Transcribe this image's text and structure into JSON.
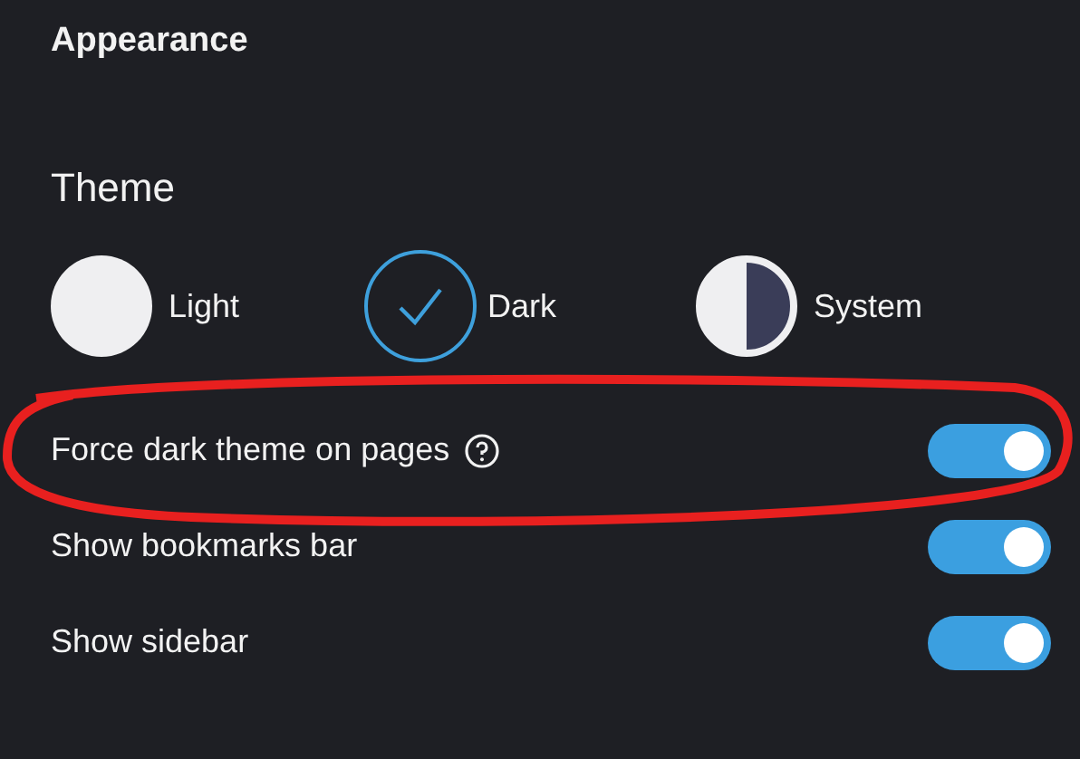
{
  "section_title": "Appearance",
  "theme": {
    "label": "Theme",
    "options": [
      {
        "kind": "light",
        "label": "Light",
        "selected": false
      },
      {
        "kind": "dark",
        "label": "Dark",
        "selected": true
      },
      {
        "kind": "system",
        "label": "System",
        "selected": false
      }
    ]
  },
  "settings": [
    {
      "label": "Force dark theme on pages",
      "help": true,
      "on": true,
      "highlighted": true
    },
    {
      "label": "Show bookmarks bar",
      "help": false,
      "on": true,
      "highlighted": false
    },
    {
      "label": "Show sidebar",
      "help": false,
      "on": true,
      "highlighted": false
    }
  ]
}
